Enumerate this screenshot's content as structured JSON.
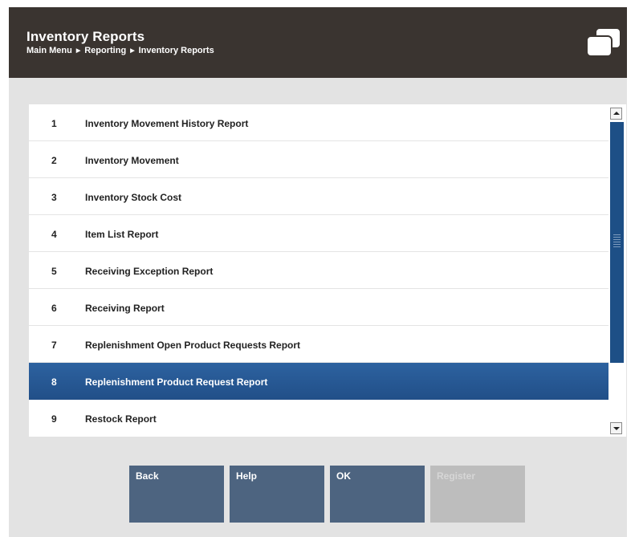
{
  "header": {
    "title": "Inventory Reports",
    "breadcrumb": [
      "Main Menu",
      "Reporting",
      "Inventory Reports"
    ]
  },
  "list": {
    "items": [
      {
        "num": "1",
        "label": "Inventory Movement History Report"
      },
      {
        "num": "2",
        "label": "Inventory Movement"
      },
      {
        "num": "3",
        "label": "Inventory Stock Cost"
      },
      {
        "num": "4",
        "label": "Item List Report"
      },
      {
        "num": "5",
        "label": "Receiving Exception Report"
      },
      {
        "num": "6",
        "label": "Receiving Report"
      },
      {
        "num": "7",
        "label": "Replenishment Open Product Requests Report"
      },
      {
        "num": "8",
        "label": "Replenishment Product Request Report"
      },
      {
        "num": "9",
        "label": "Restock Report"
      }
    ],
    "selected_index": 7
  },
  "buttons": {
    "back": "Back",
    "help": "Help",
    "ok": "OK",
    "register": "Register"
  },
  "colors": {
    "header_bg": "#3a3430",
    "selected_row": "#2a5c99",
    "button_bg": "#4d6480",
    "button_disabled_bg": "#bdbdbd"
  },
  "icons": {
    "header_icon": "windows-stack-icon",
    "scroll_up": "arrow-up-icon",
    "scroll_down": "arrow-down-icon"
  }
}
